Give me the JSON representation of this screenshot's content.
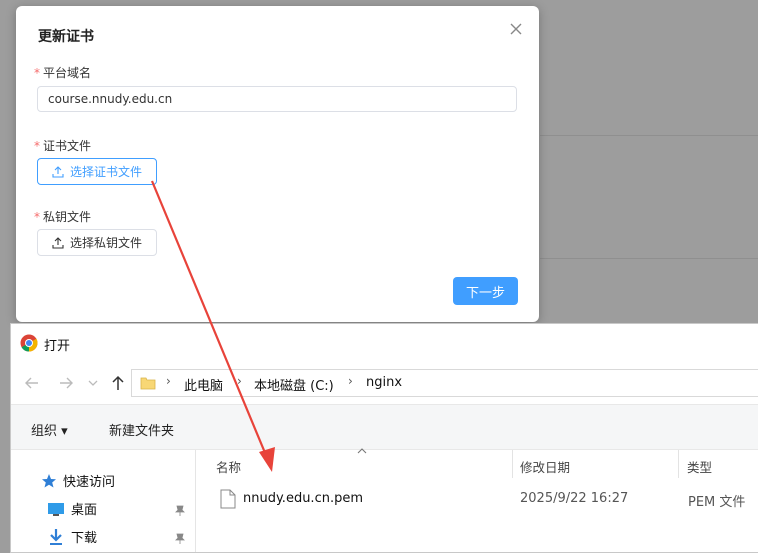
{
  "modal": {
    "title": "更新证书",
    "close_icon": "close-icon",
    "fields": {
      "domain": {
        "required_mark": "*",
        "label": "平台域名",
        "value": "course.nnudy.edu.cn"
      },
      "cert": {
        "required_mark": "*",
        "label": "证书文件",
        "button_label": "选择证书文件"
      },
      "key": {
        "required_mark": "*",
        "label": "私钥文件",
        "button_label": "选择私钥文件"
      }
    },
    "next_label": "下一步",
    "accent_color": "#409eff",
    "required_color": "#f56c6c"
  },
  "dialog": {
    "title": "打开",
    "app_icon": "chrome-icon",
    "breadcrumb": [
      "此电脑",
      "本地磁盘 (C:)",
      "nginx"
    ],
    "toolbar": {
      "organize": "组织 ▾",
      "new_folder": "新建文件夹"
    },
    "sidebar": [
      {
        "label": "快速访问",
        "icon": "star-icon"
      },
      {
        "label": "桌面",
        "icon": "desktop-icon",
        "pinned": true
      },
      {
        "label": "下载",
        "icon": "download-icon",
        "pinned": true
      }
    ],
    "columns": {
      "name": "名称",
      "modified": "修改日期",
      "type": "类型"
    },
    "files": [
      {
        "name": "nnudy.edu.cn.pem",
        "modified": "2025/9/22 16:27",
        "type": "PEM 文件"
      }
    ]
  },
  "annotation": {
    "color": "#e8433a"
  }
}
